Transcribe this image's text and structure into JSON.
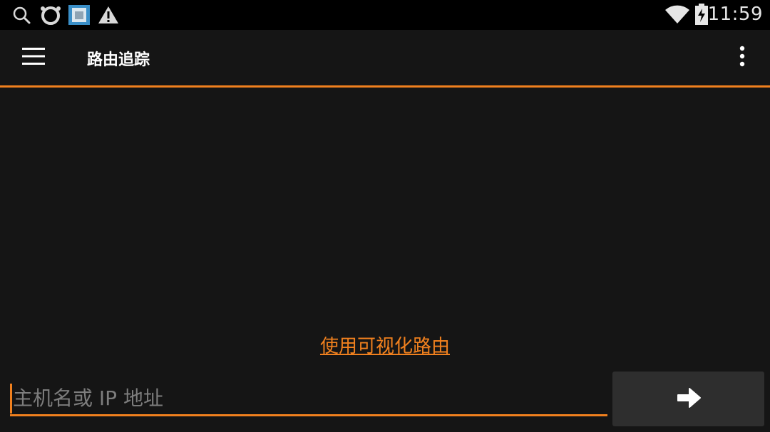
{
  "status_bar": {
    "time": "11:59",
    "left_icons": [
      "search-icon",
      "ring-app-icon",
      "image-app-icon",
      "warning-icon"
    ],
    "right_icons": [
      "wifi-icon",
      "battery-charging-icon"
    ]
  },
  "toolbar": {
    "title": "路由追踪",
    "menu_icon": "hamburger-menu-icon",
    "overflow_icon": "more-vert-icon"
  },
  "main": {
    "visual_route_link": "使用可视化路由",
    "host_input": {
      "value": "",
      "placeholder": "主机名或 IP 地址"
    },
    "go_button_icon": "arrow-right-icon"
  },
  "colors": {
    "accent": "#f0801e",
    "background": "#151515",
    "status_bar": "#000000",
    "button_bg": "#2e2e2e"
  }
}
